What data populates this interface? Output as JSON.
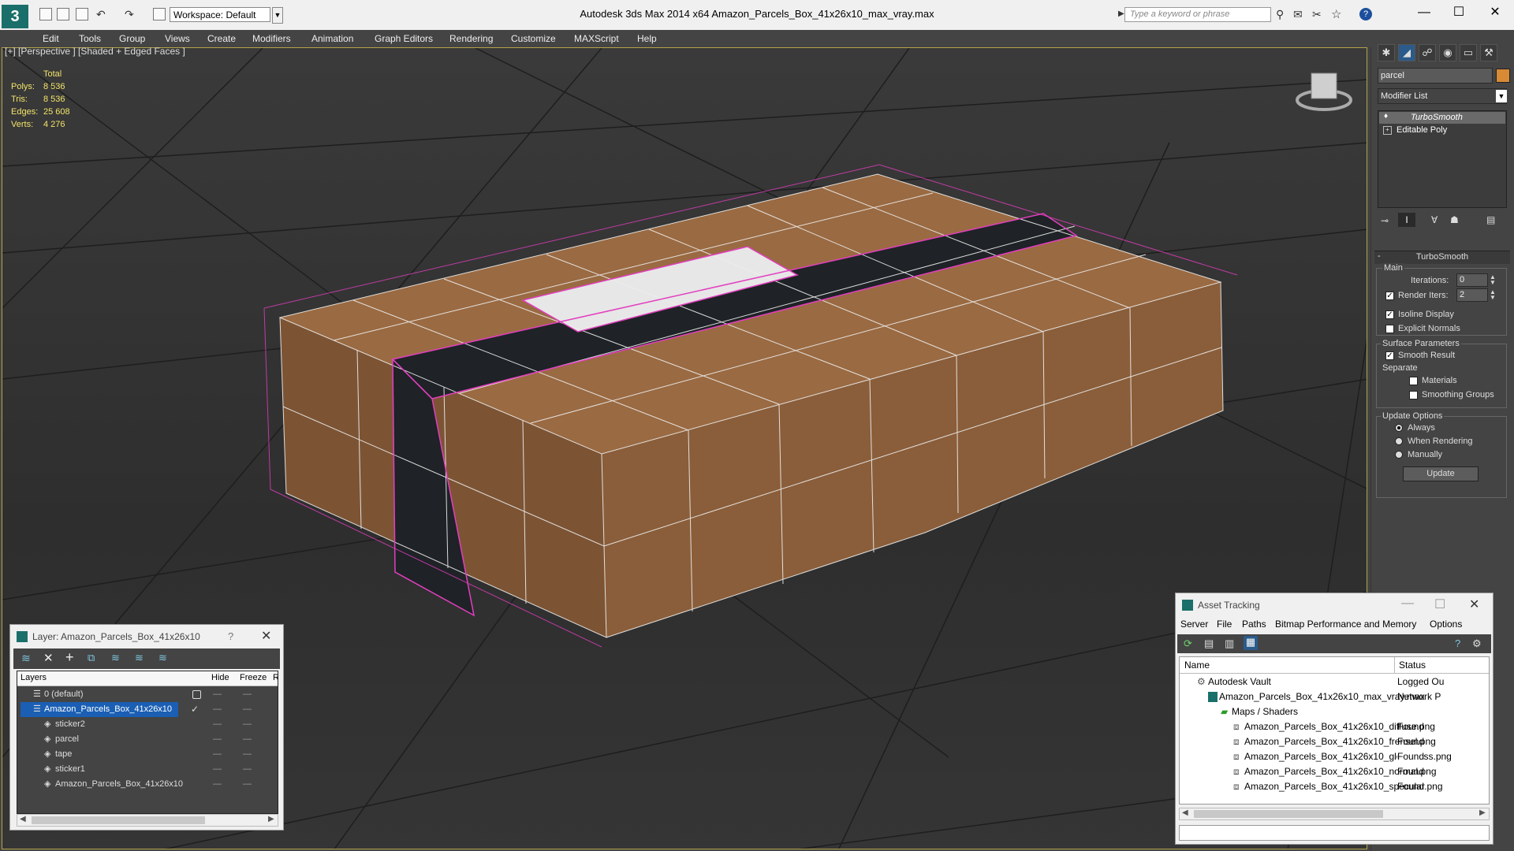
{
  "titlebar": {
    "title": "Autodesk 3ds Max  2014 x64      Amazon_Parcels_Box_41x26x10_max_vray.max",
    "workspace": "Workspace: Default",
    "search_placeholder": "Type a keyword or phrase"
  },
  "menu": [
    "Edit",
    "Tools",
    "Group",
    "Views",
    "Create",
    "Modifiers",
    "Animation",
    "Graph Editors",
    "Rendering",
    "Customize",
    "MAXScript",
    "Help"
  ],
  "viewport": {
    "label": "[+] [Perspective ] [Shaded + Edged Faces ]",
    "stats": {
      "header": "Total",
      "rows": [
        {
          "label": "Polys:",
          "value": "8 536"
        },
        {
          "label": "Tris:",
          "value": "8 536"
        },
        {
          "label": "Edges:",
          "value": "25 608"
        },
        {
          "label": "Verts:",
          "value": "4 276"
        }
      ]
    }
  },
  "command_panel": {
    "object_name": "parcel",
    "modifier_list": "Modifier List",
    "stack": [
      "TurboSmooth",
      "Editable Poly"
    ],
    "rollout_title": "TurboSmooth",
    "main_label": "Main",
    "iterations_label": "Iterations:",
    "iterations_value": "0",
    "render_iters_label": "Render Iters:",
    "render_iters_value": "2",
    "isoline_label": "Isoline Display",
    "explicit_normals_label": "Explicit Normals",
    "surface_params_label": "Surface Parameters",
    "smooth_result_label": "Smooth Result",
    "separate_label": "Separate",
    "materials_label": "Materials",
    "smoothing_groups_label": "Smoothing Groups",
    "update_options_label": "Update Options",
    "always_label": "Always",
    "when_rendering_label": "When Rendering",
    "manually_label": "Manually",
    "update_button": "Update"
  },
  "layer_dialog": {
    "title": "Layer: Amazon_Parcels_Box_41x26x10",
    "help": "?",
    "columns": [
      "Layers",
      "Hide",
      "Freeze",
      "R"
    ],
    "rows": [
      {
        "name": "0 (default)",
        "indent": 0
      },
      {
        "name": "Amazon_Parcels_Box_41x26x10",
        "indent": 0,
        "selected": true
      },
      {
        "name": "sticker2",
        "indent": 1
      },
      {
        "name": "parcel",
        "indent": 1
      },
      {
        "name": "tape",
        "indent": 1
      },
      {
        "name": "sticker1",
        "indent": 1
      },
      {
        "name": "Amazon_Parcels_Box_41x26x10",
        "indent": 1
      }
    ]
  },
  "asset_tracking": {
    "title": "Asset Tracking",
    "menu": [
      "Server",
      "File",
      "Paths",
      "Bitmap Performance and Memory",
      "Options"
    ],
    "columns": [
      "Name",
      "Status"
    ],
    "rows": [
      {
        "name": "Autodesk Vault",
        "status": "Logged Ou",
        "indent": 1
      },
      {
        "name": "Amazon_Parcels_Box_41x26x10_max_vray.max",
        "status": "Network P",
        "indent": 2
      },
      {
        "name": "Maps / Shaders",
        "status": "",
        "indent": 3
      },
      {
        "name": "Amazon_Parcels_Box_41x26x10_diffuse.png",
        "status": "Found",
        "indent": 4
      },
      {
        "name": "Amazon_Parcels_Box_41x26x10_frensel.png",
        "status": "Found",
        "indent": 4
      },
      {
        "name": "Amazon_Parcels_Box_41x26x10_glossiness.png",
        "status": "Found",
        "indent": 4
      },
      {
        "name": "Amazon_Parcels_Box_41x26x10_normal.png",
        "status": "Found",
        "indent": 4
      },
      {
        "name": "Amazon_Parcels_Box_41x26x10_specular.png",
        "status": "Found",
        "indent": 4
      }
    ]
  }
}
